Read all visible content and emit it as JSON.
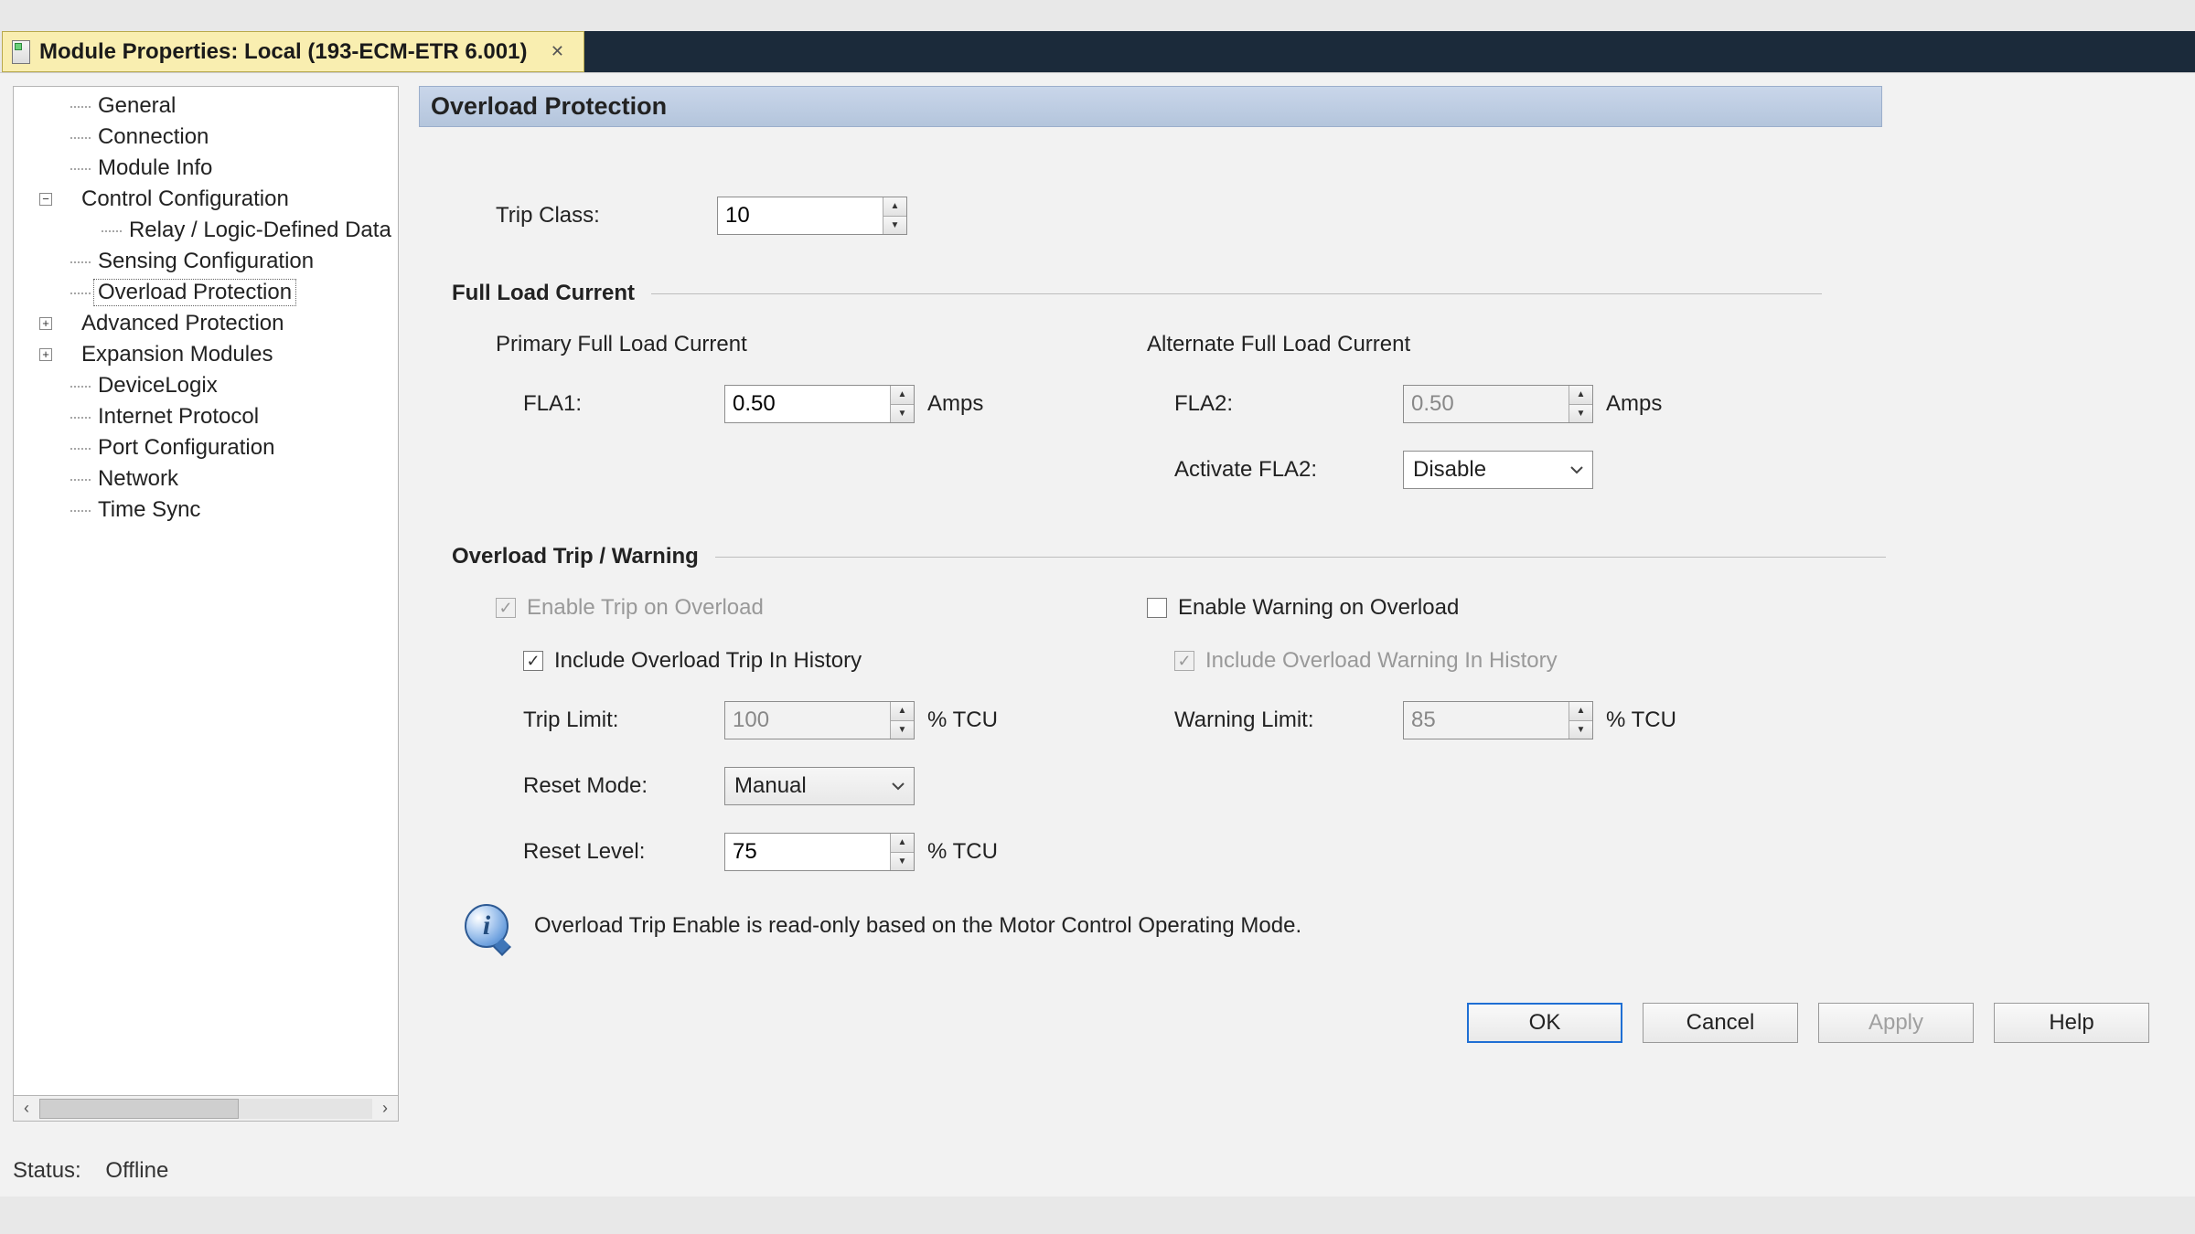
{
  "tab": {
    "title": "Module Properties: Local (193-ECM-ETR 6.001)"
  },
  "tree": {
    "items": [
      {
        "label": "General",
        "indent": 0,
        "expander": null
      },
      {
        "label": "Connection",
        "indent": 0,
        "expander": null
      },
      {
        "label": "Module Info",
        "indent": 0,
        "expander": null
      },
      {
        "label": "Control Configuration",
        "indent": 0,
        "expander": "−"
      },
      {
        "label": "Relay / Logic-Defined Data",
        "indent": 1,
        "expander": null
      },
      {
        "label": "Sensing Configuration",
        "indent": 0,
        "expander": null
      },
      {
        "label": "Overload Protection",
        "indent": 0,
        "expander": null,
        "selected": true
      },
      {
        "label": "Advanced Protection",
        "indent": 0,
        "expander": "+"
      },
      {
        "label": "Expansion Modules",
        "indent": 0,
        "expander": "+"
      },
      {
        "label": "DeviceLogix",
        "indent": 0,
        "expander": null
      },
      {
        "label": "Internet Protocol",
        "indent": 0,
        "expander": null
      },
      {
        "label": "Port Configuration",
        "indent": 0,
        "expander": null
      },
      {
        "label": "Network",
        "indent": 0,
        "expander": null
      },
      {
        "label": "Time Sync",
        "indent": 0,
        "expander": null
      }
    ]
  },
  "status": {
    "label": "Status:",
    "value": "Offline"
  },
  "page": {
    "title": "Overload Protection",
    "trip_class": {
      "label": "Trip Class:",
      "value": "10"
    },
    "sections": {
      "flc": {
        "title": "Full Load Current",
        "primary_h": "Primary Full Load Current",
        "alt_h": "Alternate Full Load Current",
        "fla1": {
          "label": "FLA1:",
          "value": "0.50",
          "unit": "Amps"
        },
        "fla2": {
          "label": "FLA2:",
          "value": "0.50",
          "unit": "Amps"
        },
        "activate_fla2": {
          "label": "Activate FLA2:",
          "value": "Disable"
        }
      },
      "otw": {
        "title": "Overload Trip / Warning",
        "enable_trip": "Enable Trip on Overload",
        "include_trip_hist": "Include Overload Trip In History",
        "enable_warn": "Enable Warning on Overload",
        "include_warn_hist": "Include Overload Warning In History",
        "trip_limit": {
          "label": "Trip Limit:",
          "value": "100",
          "unit": "% TCU"
        },
        "warn_limit": {
          "label": "Warning Limit:",
          "value": "85",
          "unit": "% TCU"
        },
        "reset_mode": {
          "label": "Reset Mode:",
          "value": "Manual"
        },
        "reset_level": {
          "label": "Reset Level:",
          "value": "75",
          "unit": "% TCU"
        }
      }
    },
    "info_text": "Overload Trip Enable is read-only based on the Motor Control Operating Mode."
  },
  "buttons": {
    "ok": "OK",
    "cancel": "Cancel",
    "apply": "Apply",
    "help": "Help"
  }
}
